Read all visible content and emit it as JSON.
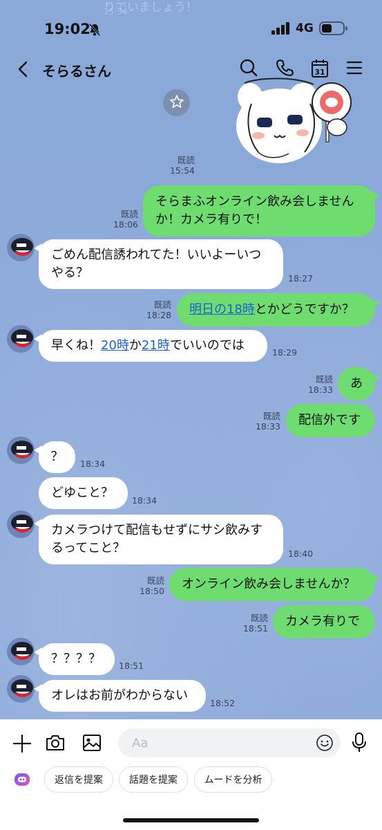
{
  "status": {
    "time": "19:02",
    "network": "4G"
  },
  "ghost": {
    "text": "りでいましょう！",
    "time": "15:54"
  },
  "header": {
    "title": "そらるさん",
    "calendar_day": "31"
  },
  "messages": [
    {
      "id": "m1",
      "dir": "out",
      "text": "そらまふオンライン飲み会しませんか！カメラ有りで！",
      "read": "既読",
      "time": "18:06"
    },
    {
      "id": "m2",
      "dir": "in",
      "text": "ごめん配信誘われてた！いいよーいつやる？",
      "time": "18:27"
    },
    {
      "id": "m3",
      "dir": "out",
      "link": "明日の18時",
      "text": "とかどうですか？",
      "read": "既読",
      "time": "18:28"
    },
    {
      "id": "m4",
      "dir": "in",
      "pre": "早くね！",
      "link1": "20時",
      "mid": "か",
      "link2": "21時",
      "post": "でいいのでは",
      "time": "18:29"
    },
    {
      "id": "m5",
      "dir": "out",
      "text": "あ",
      "read": "既読",
      "time": "18:33"
    },
    {
      "id": "m6",
      "dir": "out",
      "text": "配信外です",
      "read": "既読",
      "time": "18:33"
    },
    {
      "id": "m7",
      "dir": "in",
      "text": "？",
      "time": "18:34"
    },
    {
      "id": "m8",
      "dir": "in",
      "text": "どゆこと？",
      "time": "18:34"
    },
    {
      "id": "m9",
      "dir": "in",
      "text": "カメラつけて配信もせずにサシ飲みするってこと？",
      "time": "18:40"
    },
    {
      "id": "m10",
      "dir": "out",
      "text": "オンライン飲み会しませんか？",
      "read": "既読",
      "time": "18:50"
    },
    {
      "id": "m11",
      "dir": "out",
      "text": "カメラ有りで",
      "read": "既読",
      "time": "18:51"
    },
    {
      "id": "m12",
      "dir": "in",
      "text": "？？？？",
      "time": "18:51"
    },
    {
      "id": "m13",
      "dir": "in",
      "text": "オレはお前がわからない",
      "time": "18:52"
    }
  ],
  "sticker_meta": {
    "read": "既読",
    "time": "15:54"
  },
  "input": {
    "placeholder": "Aa"
  },
  "suggestions": [
    "返信を提案",
    "話題を提案",
    "ムードを分析"
  ],
  "icons": [
    "bell-slash-icon",
    "signal-icon",
    "battery-icon",
    "back-icon",
    "search-icon",
    "phone-icon",
    "calendar-icon",
    "menu-icon",
    "star-icon",
    "plus-icon",
    "camera-icon",
    "image-icon",
    "emoji-icon",
    "mic-icon",
    "ai-assistant-icon"
  ],
  "colors": {
    "chat_bg": "#8aa8d8",
    "outgoing_bubble": "#6edc6e",
    "incoming_bubble": "#ffffff",
    "link": "#1c5fd6"
  }
}
